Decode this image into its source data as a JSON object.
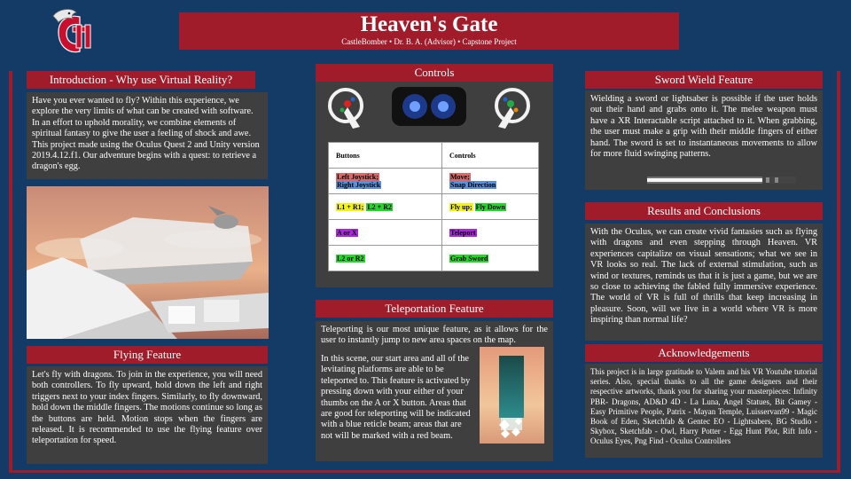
{
  "header": {
    "title": "Heaven's Gate",
    "subtitle": "CastleBomber • Dr. B. A. (Advisor)  • Capstone Project"
  },
  "colors": {
    "background": "#143b66",
    "accent": "#a01c2a",
    "panel": "#3f3f3f"
  },
  "logo": {
    "icon": "hawk-c-logo"
  },
  "sections": {
    "introduction": {
      "heading": "Introduction - Why use Virtual Reality?",
      "body": "Have you ever wanted to fly? Within this experience, we explore the very limits of what can be created with software. In an effort to uphold morality, we combine elements of spiritual fantasy to give the user a feeling of shock and awe. This project made using the Oculus Quest 2 and Unity version 2019.4.12.f1. Our adventure begins with a quest: to retrieve a dragon's egg."
    },
    "flying": {
      "heading": "Flying Feature",
      "body": "Let's fly with dragons. To join in the experience, you will need both controllers. To fly upward, hold down the left and right triggers next to your index fingers. Similarly, to fly downward, hold down the middle fingers. The motions continue so long as the buttons are held. Motion stops when the fingers are released. It is recommended to use the flying feature over teleportation for speed."
    },
    "controls": {
      "heading": "Controls",
      "table": {
        "col1": "Buttons",
        "col2": "Controls",
        "rows": [
          {
            "a1": "Left Joystick;",
            "a2": "Right Joystick",
            "b1": "Move;",
            "b2": "Snap Direction"
          },
          {
            "a1": "L1 + R1;",
            "a2": "L2 + R2",
            "b1": "Fly up;",
            "b2": "Fly Down"
          },
          {
            "a1": "A or X",
            "b1": "Teleport"
          },
          {
            "a1": "L2 or R2",
            "b1": "Grab Sword"
          }
        ]
      }
    },
    "teleportation": {
      "heading": "Teleportation Feature",
      "body_top": "Teleporting is our most unique feature, as it allows for the user to  instantly jump to new area spaces on the map.",
      "body_rest": "In this scene, our start area and all of the levitating platforms are able to be teleported to. This feature is activated by pressing down with your either of your thumbs on the A or X button. Areas that are good for teleporting will be indicated with a blue reticle beam; areas that are not will be marked with a red beam."
    },
    "sword": {
      "heading": "Sword Wield Feature",
      "body": "Wielding a sword or lightsaber is possible if the user holds out their hand and grabs onto it. The melee weapon must have a XR Interactable script attached to it. When grabbing, the user must make a grip with their middle fingers of either hand. The sword is set to instantaneous movements to allow for more fluid swinging patterns."
    },
    "results": {
      "heading": "Results and Conclusions",
      "body": "With the Oculus, we can create vivid fantasies such as flying with dragons and even stepping through Heaven. VR experiences capitalize on visual sensations; what we see in VR looks so real. The lack of external stimulation, such as wind or textures, reminds us that it is just a game, but we are so close to achieving the fabled fully immersive experience. The world of VR is full of thrills that keep increasing in pleasure. Soon, will we live in a world where VR is more inspiring than normal life?"
    },
    "acknowledgements": {
      "heading": "Acknowledgements",
      "body": "This project is in large gratitude to Valem and his VR Youtube tutorial series. Also, special thanks to all the game designers and their respective artworks, thank you for sharing your masterpieces: Infinity PBR- Dragons, AD&D 4D - La Luna, Angel Statues, Bit Gamey - Easy Primitive People, Patrix - Mayan Temple, Luisservan99 - Magic Book of Eden, Sketchfab & Gentec EO - Lightsabers, BG Studio - Skybox, Sketchfab - Owl,  Harry Potter - Egg Hunt Plot, Rift Info - Oculus Eyes, Png Find - Oculus Controllers"
    }
  }
}
